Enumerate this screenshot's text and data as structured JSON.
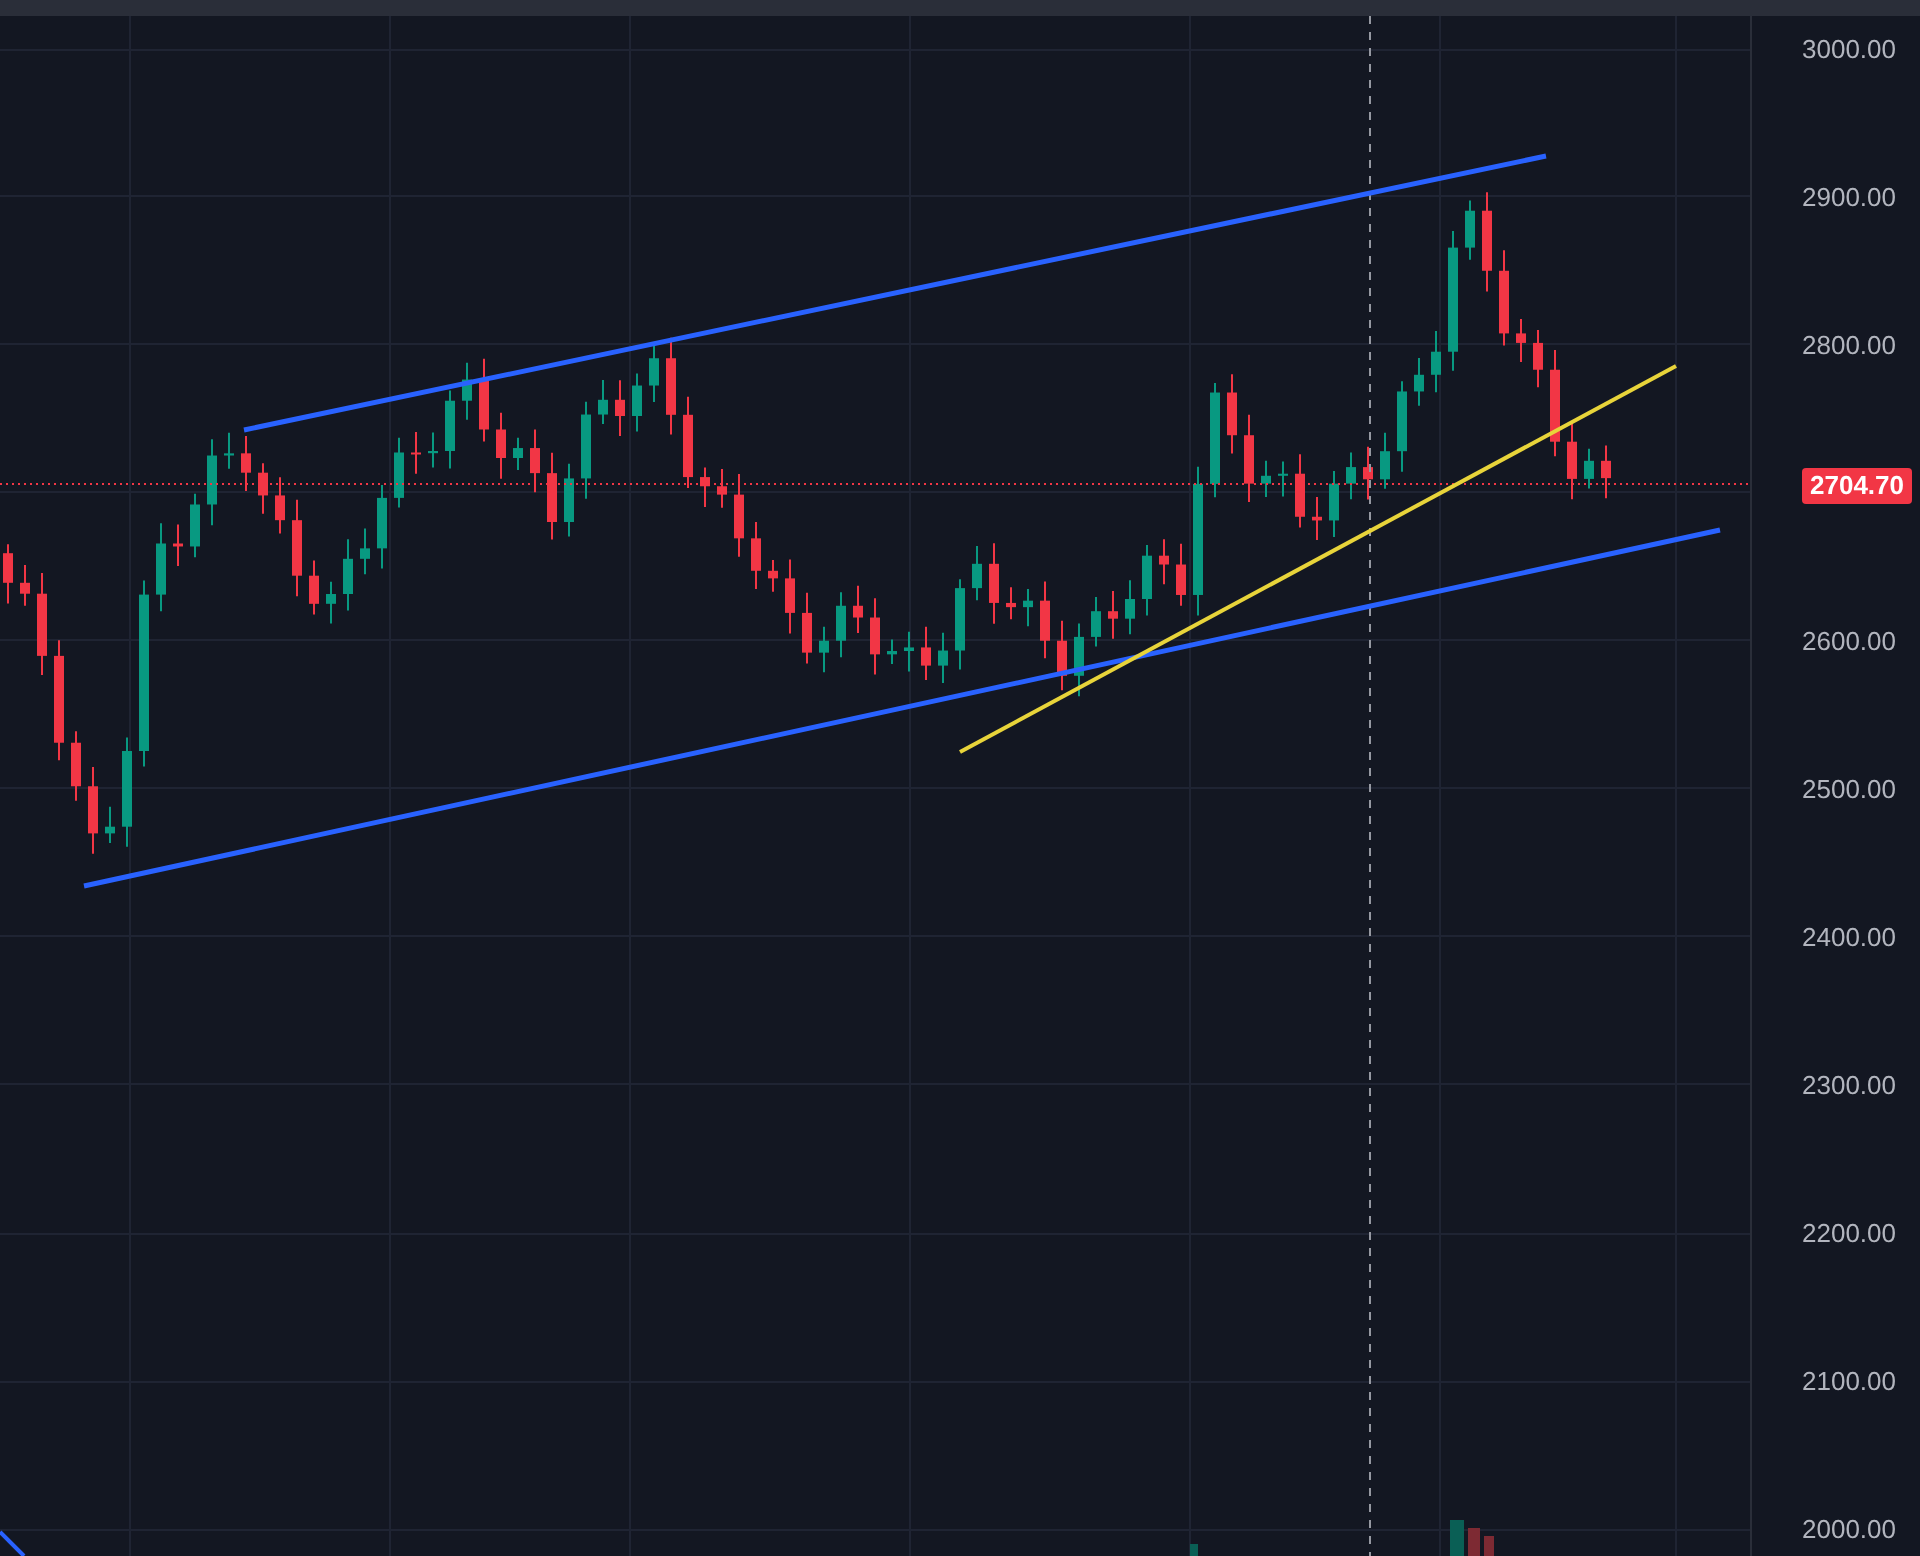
{
  "chart": {
    "price_axis": [
      {
        "kind": "tick",
        "text": "3000.00"
      },
      {
        "kind": "tick",
        "text": "2900.00"
      },
      {
        "kind": "tick",
        "text": "2800.00"
      },
      {
        "kind": "badge",
        "text": "2704.70"
      },
      {
        "kind": "tick",
        "text": "2600.00"
      },
      {
        "kind": "tick",
        "text": "2500.00"
      },
      {
        "kind": "tick",
        "text": "2400.00"
      },
      {
        "kind": "tick",
        "text": "2300.00"
      },
      {
        "kind": "tick",
        "text": "2200.00"
      },
      {
        "kind": "tick",
        "text": "2100.00"
      },
      {
        "kind": "tick",
        "text": "2000.00"
      }
    ]
  }
}
